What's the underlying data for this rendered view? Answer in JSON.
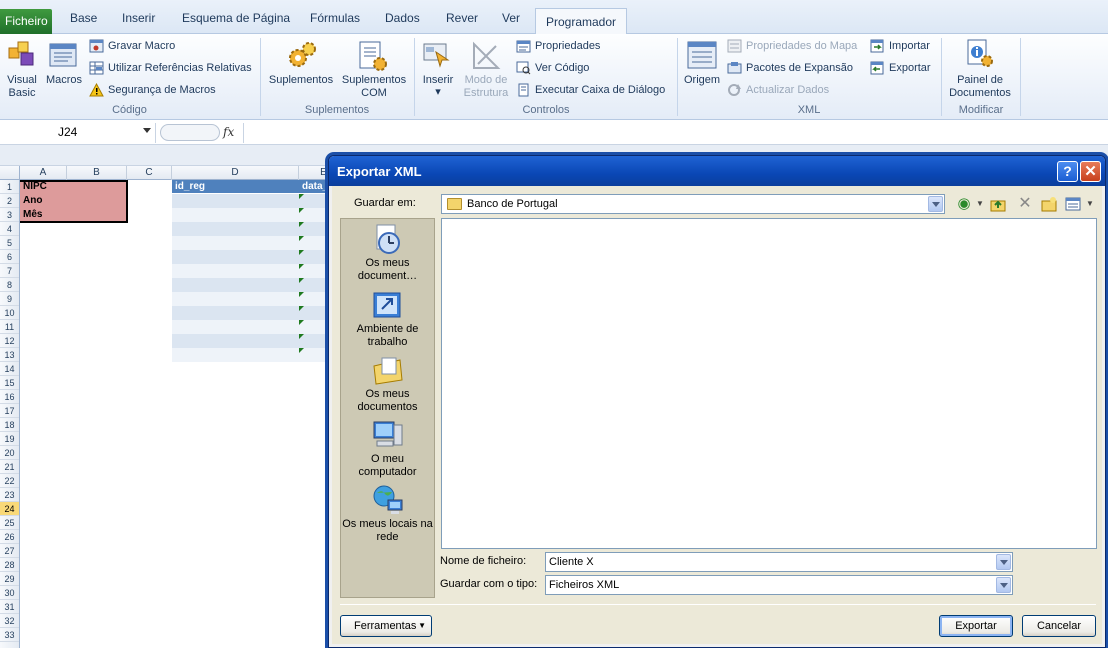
{
  "ribbon": {
    "tabs": {
      "file": "Ficheiro",
      "home": "Base",
      "insert": "Inserir",
      "page_layout": "Esquema de Página",
      "formulas": "Fórmulas",
      "data": "Dados",
      "review": "Rever",
      "view": "Ver",
      "developer": "Programador"
    },
    "code_group": {
      "label": "Código",
      "visual_basic": "Visual Basic",
      "macros": "Macros",
      "record_macro": "Gravar Macro",
      "relative_refs": "Utilizar Referências Relativas",
      "macro_security": "Segurança de Macros"
    },
    "addins_group": {
      "label": "Suplementos",
      "addins": "Suplementos",
      "com_addins": "Suplementos COM"
    },
    "controls_group": {
      "label": "Controlos",
      "insert": "Inserir",
      "design_mode": "Modo de Estrutura",
      "properties": "Propriedades",
      "view_code": "Ver Código",
      "run_dialog": "Executar Caixa de Diálogo"
    },
    "xml_group": {
      "label": "XML",
      "source": "Origem",
      "map_properties": "Propriedades do Mapa",
      "expansion_packs": "Pacotes de Expansão",
      "refresh_data": "Actualizar Dados",
      "import": "Importar",
      "export": "Exportar"
    },
    "modify_group": {
      "label": "Modificar",
      "document_panel": "Painel de Documentos"
    }
  },
  "formula_bar": {
    "name_box": "J24",
    "fx": "fx",
    "value": ""
  },
  "sheet": {
    "columns": [
      "A",
      "B",
      "C",
      "D",
      "E"
    ],
    "rows": [
      "1",
      "2",
      "3",
      "4",
      "5",
      "6",
      "7",
      "8",
      "9",
      "10",
      "11",
      "12",
      "13",
      "14",
      "15",
      "16",
      "17",
      "18",
      "19",
      "20",
      "21",
      "22",
      "23",
      "24",
      "25",
      "26",
      "27",
      "28",
      "29",
      "30",
      "31",
      "32",
      "33"
    ],
    "active_row": "24",
    "cells": {
      "a1": "NIPC",
      "a2": "Ano",
      "a3": "Mês",
      "d1": "id_reg",
      "e1": "data_"
    },
    "colors": {
      "label_fill": "#dd9b9b",
      "header_fill": "#4f81bd",
      "stripe_dark": "#dbe5f1",
      "stripe_light": "#eef3f9"
    }
  },
  "dialog": {
    "title": "Exportar XML",
    "help": "?",
    "close": "✕",
    "save_in_label": "Guardar em:",
    "save_in_value": "Banco de Portugal",
    "places": [
      {
        "label": "Os meus documentos recentes",
        "display": "Os meus document…",
        "icon": "recent-documents-icon"
      },
      {
        "label": "Ambiente de trabalho",
        "display": "Ambiente de trabalho",
        "icon": "desktop-icon"
      },
      {
        "label": "Os meus documentos",
        "display": "Os meus documentos",
        "icon": "my-documents-icon"
      },
      {
        "label": "O meu computador",
        "display": "O meu computador",
        "icon": "my-computer-icon"
      },
      {
        "label": "Os meus locais na rede",
        "display": "Os meus locais na rede",
        "icon": "network-places-icon"
      }
    ],
    "file_name_label": "Nome de ficheiro:",
    "file_name_value": "Cliente X",
    "file_type_label": "Guardar com o tipo:",
    "file_type_value": "Ficheiros XML",
    "tools_button": "Ferramentas",
    "export_button": "Exportar",
    "cancel_button": "Cancelar"
  }
}
